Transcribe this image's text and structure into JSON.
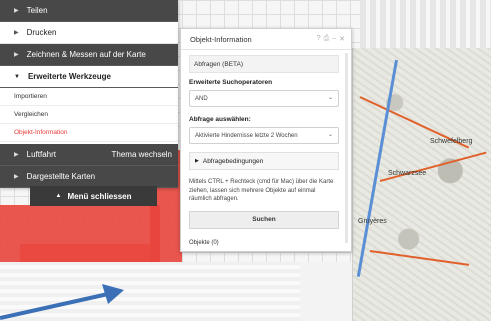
{
  "panel": {
    "items": [
      {
        "label": "Teilen"
      },
      {
        "label": "Drucken"
      },
      {
        "label": "Zeichnen & Messen auf der Karte"
      },
      {
        "label": "Erweiterte Werkzeuge"
      }
    ],
    "subitems": [
      "Importieren",
      "Vergleichen",
      "Objekt-Information"
    ],
    "luftfahrt": "Luftfahrt",
    "thema_wechseln": "Thema wechseln",
    "dargestellte_karten": "Dargestellte Karten",
    "close_menu": "Menü schliessen"
  },
  "dialog": {
    "title": "Objekt-Information",
    "tab": "Abfragen (BETA)",
    "operators_label": "Erweiterte Suchoperatoren",
    "operators_value": "AND",
    "query_label": "Abfrage auswählen:",
    "query_value": "Aktivierte Hindernisse letzte 2 Wochen",
    "conditions": "Abfragebedingungen",
    "description": "Mittels CTRL + Rechteck (cmd für Mac) über die Karte ziehen, lassen sich mehrere Objekte auf einmal räumlich abfragen.",
    "search_button": "Suchen",
    "objects": "Objekte (0)"
  },
  "map": {
    "labels": [
      "Schwefelberg",
      "Schwarzsee",
      "Gruyères"
    ]
  },
  "colors": {
    "accent": "#e53935",
    "panel_dark": "#484848",
    "arrow": "#3b6fb6"
  }
}
